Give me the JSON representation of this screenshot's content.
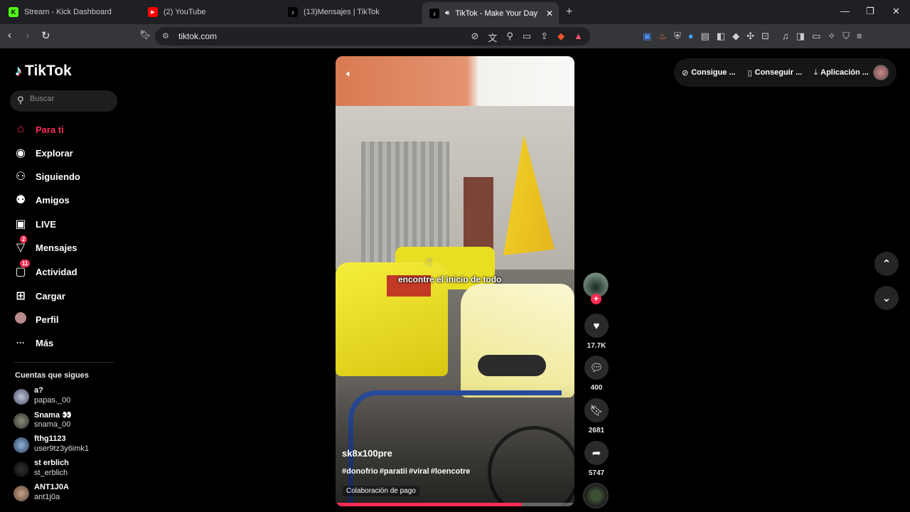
{
  "browser": {
    "tabs": [
      {
        "title": "Stream - Kick Dashboard",
        "favicon": "kick-icon",
        "color": "#53fc18",
        "glyph": "K"
      },
      {
        "title": "(2) YouTube",
        "favicon": "youtube-icon",
        "color": "#ff0000",
        "glyph": "▶"
      },
      {
        "title": "(13)Mensajes | TikTok",
        "favicon": "tiktok-icon",
        "color": "#000000",
        "glyph": "♪"
      },
      {
        "title": "TikTok - Make Your Day",
        "favicon": "tiktok-icon",
        "color": "#000000",
        "glyph": "♪",
        "audio": "speaker-icon"
      }
    ],
    "url": "tiktok.com"
  },
  "sidebar": {
    "logo_text": "TikTok",
    "search_placeholder": "Buscar",
    "items": [
      {
        "label": "Para ti",
        "icon": "home-icon",
        "glyph": "⌂",
        "active": true
      },
      {
        "label": "Explorar",
        "icon": "compass-icon",
        "glyph": "◉"
      },
      {
        "label": "Siguiendo",
        "icon": "following-icon",
        "glyph": "⚇"
      },
      {
        "label": "Amigos",
        "icon": "friends-icon",
        "glyph": "⚉"
      },
      {
        "label": "LIVE",
        "icon": "live-icon",
        "glyph": "▣"
      },
      {
        "label": "Mensajes",
        "icon": "messages-icon",
        "glyph": "▽",
        "badge": "2"
      },
      {
        "label": "Actividad",
        "icon": "activity-icon",
        "glyph": "▢",
        "badge": "11"
      },
      {
        "label": "Cargar",
        "icon": "upload-icon",
        "glyph": "⊞"
      },
      {
        "label": "Perfil",
        "icon": "profile-icon",
        "glyph": "●"
      },
      {
        "label": "Más",
        "icon": "more-icon",
        "glyph": "···"
      }
    ],
    "follows_title": "Cuentas que sigues",
    "follows": [
      {
        "name": "a?",
        "handle": "papas._00"
      },
      {
        "name": "Snama 👀",
        "handle": "snama_00"
      },
      {
        "name": "fthg1123",
        "handle": "user9tz3y6imk1"
      },
      {
        "name": "st erblich",
        "handle": "st_erblich"
      },
      {
        "name": "ANT1J0A",
        "handle": "ant1j0a"
      }
    ]
  },
  "video": {
    "caption_overlay": "encontre el inicio de todo",
    "author": "sk8x100pre",
    "hashtags": "#donofrio #paratii #viral #loencotre",
    "paid_label": "Colaboración de pago",
    "progress": 0.78
  },
  "actions": {
    "likes": "17.7K",
    "comments": "400",
    "saves": "2681",
    "shares": "5747"
  },
  "topbar": {
    "item1": "Consigue ...",
    "item2": "Conseguir ...",
    "item3": "Aplicación ..."
  },
  "colors": {
    "accent": "#fe2c55",
    "background": "#000000"
  }
}
